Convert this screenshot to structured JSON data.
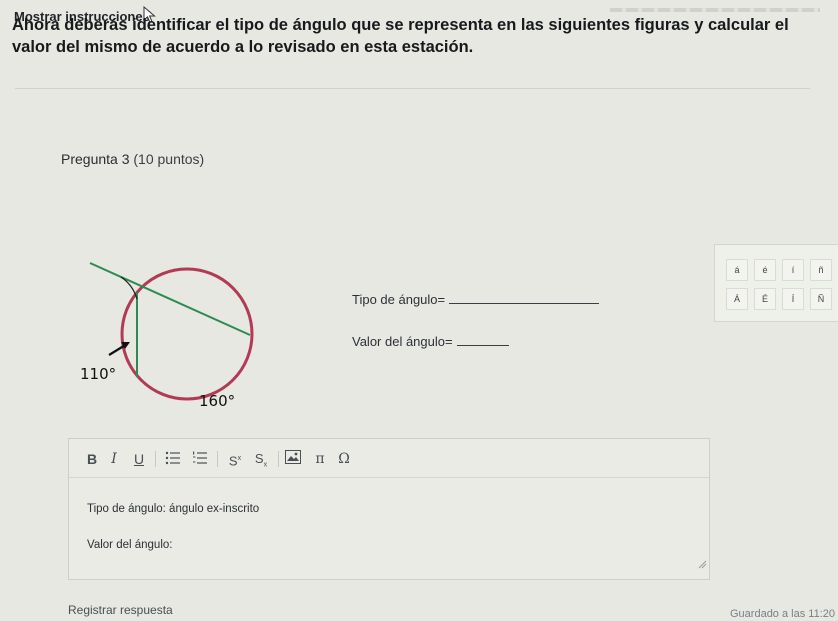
{
  "header": {
    "show_instructions_link": "Mostrar instrucciones"
  },
  "instructions": "Ahora deberás identificar el tipo de ángulo que se representa en las siguientes figuras y calcular el valor del mismo de acuerdo a lo revisado en esta estación.",
  "question": {
    "title": "Pregunta 3",
    "points": "(10 puntos)",
    "figure": {
      "angle_label": "110°",
      "arc_label": "160°",
      "circle_color": "#b23a55",
      "line_color": "#2f8a52"
    },
    "type_prompt": "Tipo de ángulo=",
    "value_prompt": "Valor del ángulo="
  },
  "char_panel": {
    "row1": [
      "á",
      "é",
      "í",
      "ñ"
    ],
    "row2": [
      "Á",
      "É",
      "Í",
      "Ñ"
    ]
  },
  "editor": {
    "toolbar": {
      "bold": "B",
      "italic": "I",
      "underline": "U",
      "superscript": "S",
      "superscript_mark": "x",
      "subscript": "S",
      "subscript_mark": "x",
      "pi": "π",
      "omega": "Ω"
    },
    "line1": "Tipo de ángulo: ángulo ex-inscrito",
    "line2": "Valor del ángulo:"
  },
  "footer": {
    "submit_label": "Registrar respuesta",
    "saved_status": "Guardado a las 11:20"
  }
}
